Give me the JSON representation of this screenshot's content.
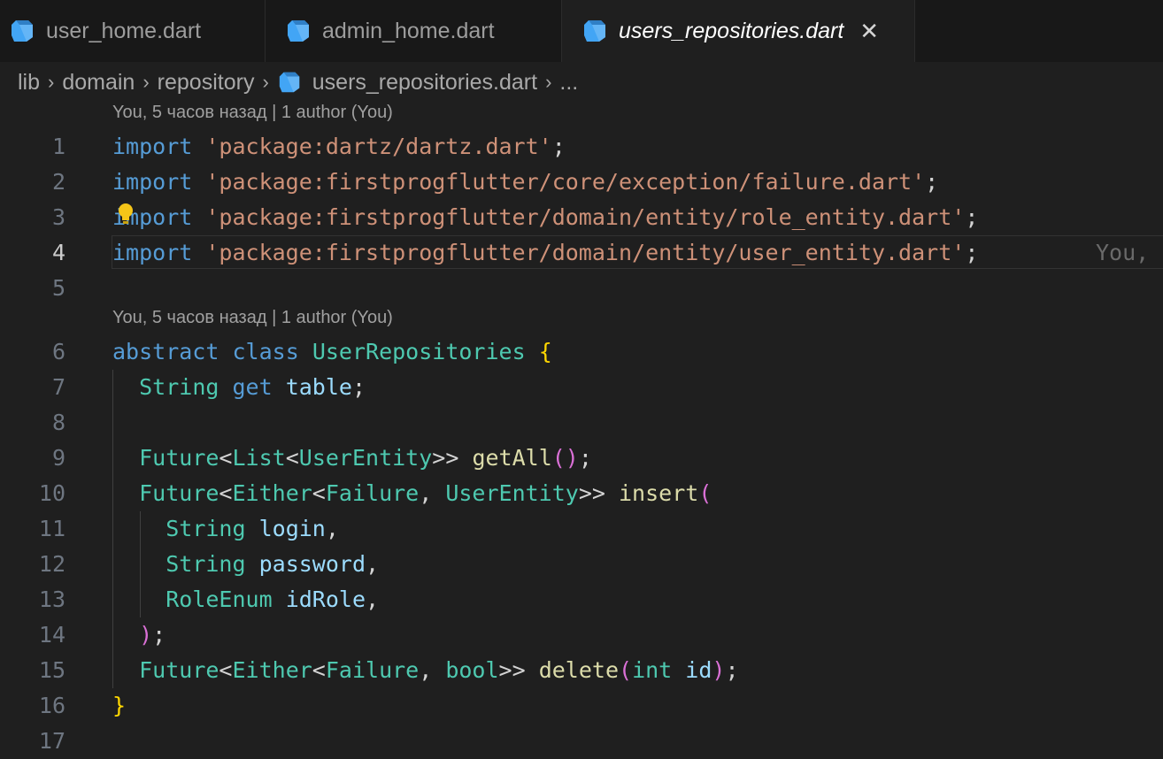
{
  "tabs": [
    {
      "label": "user_home.dart",
      "active": false
    },
    {
      "label": "admin_home.dart",
      "active": false
    },
    {
      "label": "users_repositories.dart",
      "active": true
    }
  ],
  "close_glyph": "✕",
  "breadcrumb": {
    "items": [
      "lib",
      "domain",
      "repository",
      "users_repositories.dart",
      "..."
    ],
    "separator": "›"
  },
  "codelens": {
    "import_block": "You, 5 часов назад | 1 author (You)",
    "class_block": "You, 5 часов назад | 1 author (You)"
  },
  "blame_ghost": "You,",
  "current_line": 4,
  "colors": {
    "keyword": "#569cd6",
    "string": "#ce9178",
    "type": "#4ec9b0",
    "variable": "#9cdcfe",
    "function": "#dcdcaa",
    "bracket_level1": "#ffd700",
    "bracket_level2": "#da70d6",
    "dart_icon": "#42a5f5"
  },
  "icons": {
    "file_icon": "dart-file-icon",
    "lightbulb": "lightbulb-icon"
  },
  "lines": [
    {
      "n": "1",
      "tokens": [
        [
          "kw",
          "import"
        ],
        [
          "pun",
          " "
        ],
        [
          "str",
          "'package:dartz/dartz.dart'"
        ],
        [
          "pun",
          ";"
        ]
      ]
    },
    {
      "n": "2",
      "tokens": [
        [
          "kw",
          "import"
        ],
        [
          "pun",
          " "
        ],
        [
          "str",
          "'package:firstprogflutter/core/exception/failure.dart'"
        ],
        [
          "pun",
          ";"
        ]
      ]
    },
    {
      "n": "3",
      "tokens": [
        [
          "kw",
          "import"
        ],
        [
          "pun",
          " "
        ],
        [
          "str",
          "'package:firstprogflutter/domain/entity/role_entity.dart'"
        ],
        [
          "pun",
          ";"
        ]
      ]
    },
    {
      "n": "4",
      "tokens": [
        [
          "kw",
          "import"
        ],
        [
          "pun",
          " "
        ],
        [
          "str",
          "'package:firstprogflutter/domain/entity/user_entity.dart'"
        ],
        [
          "pun",
          ";"
        ]
      ]
    },
    {
      "n": "5",
      "tokens": []
    },
    {
      "n": "6",
      "tokens": [
        [
          "kw",
          "abstract"
        ],
        [
          "pun",
          " "
        ],
        [
          "kw",
          "class"
        ],
        [
          "pun",
          " "
        ],
        [
          "typ",
          "UserRepositories"
        ],
        [
          "pun",
          " "
        ],
        [
          "br1",
          "{"
        ]
      ]
    },
    {
      "n": "7",
      "tokens": [
        [
          "pun",
          "  "
        ],
        [
          "typ",
          "String"
        ],
        [
          "pun",
          " "
        ],
        [
          "kw",
          "get"
        ],
        [
          "pun",
          " "
        ],
        [
          "var",
          "table"
        ],
        [
          "pun",
          ";"
        ]
      ]
    },
    {
      "n": "8",
      "tokens": []
    },
    {
      "n": "9",
      "tokens": [
        [
          "pun",
          "  "
        ],
        [
          "typ",
          "Future"
        ],
        [
          "pun",
          "<"
        ],
        [
          "typ",
          "List"
        ],
        [
          "pun",
          "<"
        ],
        [
          "typ",
          "UserEntity"
        ],
        [
          "pun",
          ">> "
        ],
        [
          "fn",
          "getAll"
        ],
        [
          "br2",
          "()"
        ],
        [
          "pun",
          ";"
        ]
      ]
    },
    {
      "n": "10",
      "tokens": [
        [
          "pun",
          "  "
        ],
        [
          "typ",
          "Future"
        ],
        [
          "pun",
          "<"
        ],
        [
          "typ",
          "Either"
        ],
        [
          "pun",
          "<"
        ],
        [
          "typ",
          "Failure"
        ],
        [
          "pun",
          ", "
        ],
        [
          "typ",
          "UserEntity"
        ],
        [
          "pun",
          ">> "
        ],
        [
          "fn",
          "insert"
        ],
        [
          "br2",
          "("
        ]
      ]
    },
    {
      "n": "11",
      "tokens": [
        [
          "pun",
          "    "
        ],
        [
          "typ",
          "String"
        ],
        [
          "pun",
          " "
        ],
        [
          "var",
          "login"
        ],
        [
          "pun",
          ","
        ]
      ]
    },
    {
      "n": "12",
      "tokens": [
        [
          "pun",
          "    "
        ],
        [
          "typ",
          "String"
        ],
        [
          "pun",
          " "
        ],
        [
          "var",
          "password"
        ],
        [
          "pun",
          ","
        ]
      ]
    },
    {
      "n": "13",
      "tokens": [
        [
          "pun",
          "    "
        ],
        [
          "typ",
          "RoleEnum"
        ],
        [
          "pun",
          " "
        ],
        [
          "var",
          "idRole"
        ],
        [
          "pun",
          ","
        ]
      ]
    },
    {
      "n": "14",
      "tokens": [
        [
          "pun",
          "  "
        ],
        [
          "br2",
          ")"
        ],
        [
          "pun",
          ";"
        ]
      ]
    },
    {
      "n": "15",
      "tokens": [
        [
          "pun",
          "  "
        ],
        [
          "typ",
          "Future"
        ],
        [
          "pun",
          "<"
        ],
        [
          "typ",
          "Either"
        ],
        [
          "pun",
          "<"
        ],
        [
          "typ",
          "Failure"
        ],
        [
          "pun",
          ", "
        ],
        [
          "typ",
          "bool"
        ],
        [
          "pun",
          ">> "
        ],
        [
          "fn",
          "delete"
        ],
        [
          "br2",
          "("
        ],
        [
          "typ",
          "int"
        ],
        [
          "pun",
          " "
        ],
        [
          "var",
          "id"
        ],
        [
          "br2",
          ")"
        ],
        [
          "pun",
          ";"
        ]
      ]
    },
    {
      "n": "16",
      "tokens": [
        [
          "br1",
          "}"
        ]
      ]
    },
    {
      "n": "17",
      "tokens": []
    }
  ]
}
